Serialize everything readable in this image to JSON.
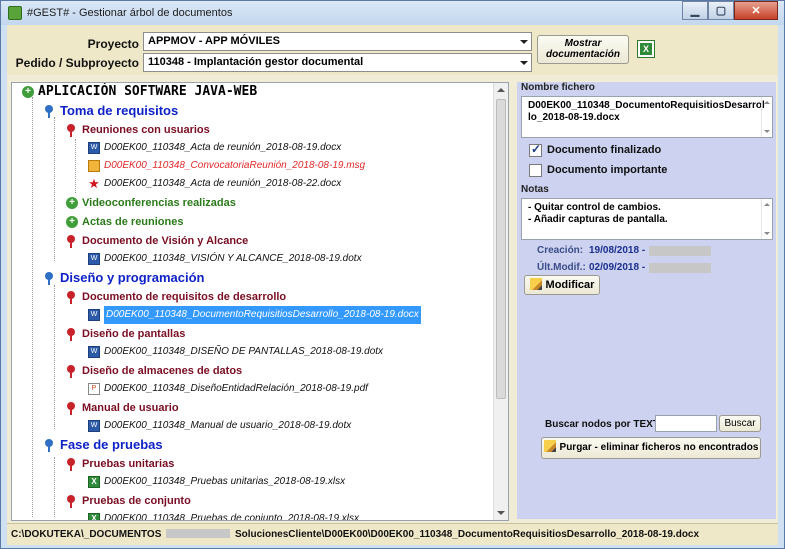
{
  "window": {
    "title": "#GEST# - Gestionar árbol de documentos",
    "minimize": "▁",
    "maximize": "▢",
    "close": "✕"
  },
  "header": {
    "proyecto_label": "Proyecto",
    "proyecto_value": "APPMOV - APP MÓVILES",
    "pedido_label": "Pedido / Subproyecto",
    "pedido_value": "110348 - Implantación gestor documental",
    "mostrar_btn": "Mostrar\ndocumentación",
    "excel_icon": "excel-icon"
  },
  "tree": {
    "root": "APLICACIÓN SOFTWARE JAVA-WEB",
    "n1": "Toma de requisitos",
    "n1a": "Reuniones con usuarios",
    "f1": "D00EK00_110348_Acta de reunión_2018-08-19.docx",
    "f2": "D00EK00_110348_ConvocatoriaReunión_2018-08-19.msg",
    "f3": "D00EK00_110348_Acta de reunión_2018-08-22.docx",
    "n1b": "Videoconferencias realizadas",
    "n1c": "Actas de reuniones",
    "n1d": "Documento de Visión y Alcance",
    "f4": "D00EK00_110348_VISIÓN Y ALCANCE_2018-08-19.dotx",
    "n2": "Diseño y programación",
    "n2a": "Documento de requisitos de desarrollo",
    "f5": "D00EK00_110348_DocumentoRequisitiosDesarrollo_2018-08-19.docx",
    "n2b": "Diseño de pantallas",
    "f6": "D00EK00_110348_DISEÑO DE PANTALLAS_2018-08-19.dotx",
    "n2c": "Diseño de almacenes de datos",
    "f7": "D00EK00_110348_DiseñoEntidadRelación_2018-08-19.pdf",
    "n2d": "Manual de usuario",
    "f8": "D00EK00_110348_Manual de usuario_2018-08-19.dotx",
    "n3": "Fase de pruebas",
    "n3a": "Pruebas unitarias",
    "f9": "D00EK00_110348_Pruebas unitarias_2018-08-19.xlsx",
    "n3b": "Pruebas de conjunto",
    "f10": "D00EK00_110348_Pruebas de conjunto_2018-08-19.xlsx"
  },
  "details": {
    "nombre_label": "Nombre fichero",
    "nombre_value": "D00EK00_110348_DocumentoRequisitiosDesarrollo_2018-08-19.docx",
    "finalizado_label": "Documento finalizado",
    "finalizado_checked": true,
    "importante_label": "Documento importante",
    "importante_checked": false,
    "notas_label": "Notas",
    "nota1": "- Quitar control de cambios.",
    "nota2": "- Añadir capturas de pantalla.",
    "creacion_label": "Creación:",
    "creacion_value": "19/08/2018 -",
    "modif_label": "Últ.Modif.:",
    "modif_value": "02/09/2018 -",
    "modificar_btn": "Modificar",
    "buscar_label": "Buscar nodos por TEXT",
    "buscar_value": "",
    "buscar_btn": "Buscar",
    "purgar_btn": "Purgar - eliminar ficheros no encontrados"
  },
  "status": {
    "path_a": "C:\\DOKUTEKA\\_DOCUMENTOS",
    "path_b": "SolucionesCliente\\D00EK00\\D00EK00_110348_DocumentoRequisitiosDesarrollo_2018-08-19.docx"
  }
}
